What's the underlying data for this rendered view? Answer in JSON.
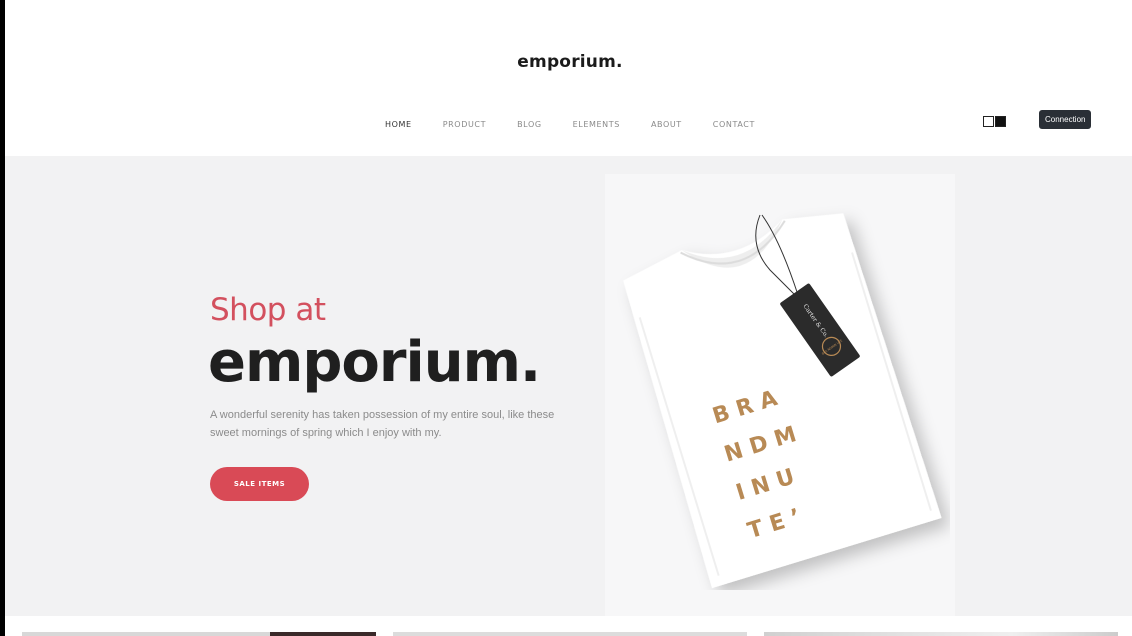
{
  "header": {
    "logo": "emporium.",
    "nav": [
      {
        "label": "HOME",
        "active": true
      },
      {
        "label": "PRODUCT",
        "active": false
      },
      {
        "label": "BLOG",
        "active": false
      },
      {
        "label": "ELEMENTS",
        "active": false
      },
      {
        "label": "ABOUT",
        "active": false
      },
      {
        "label": "CONTACT",
        "active": false
      }
    ],
    "view_toggle_icons": [
      "outline-square-icon",
      "filled-square-icon"
    ],
    "connection_button": "Connection"
  },
  "hero": {
    "subtitle": "Shop at",
    "title": "emporium.",
    "description": "A wonderful serenity has taken possession of my entire soul, like these sweet mornings of spring which I enjoy with my.",
    "cta_label": "SALE ITEMS",
    "tshirt_print": [
      "B R A",
      "N D M",
      "I N U",
      "T E ʼ"
    ],
    "tag_text": "Carter & Co.",
    "tag_badge": "BRA NDMIN UTE"
  },
  "colors": {
    "accent": "#d94a56",
    "subtitle": "#d3505e",
    "hero_bg": "#f2f2f3",
    "text_dark": "#1f1f1f",
    "button_dark": "#2a2f36",
    "gold": "#b88a55"
  }
}
